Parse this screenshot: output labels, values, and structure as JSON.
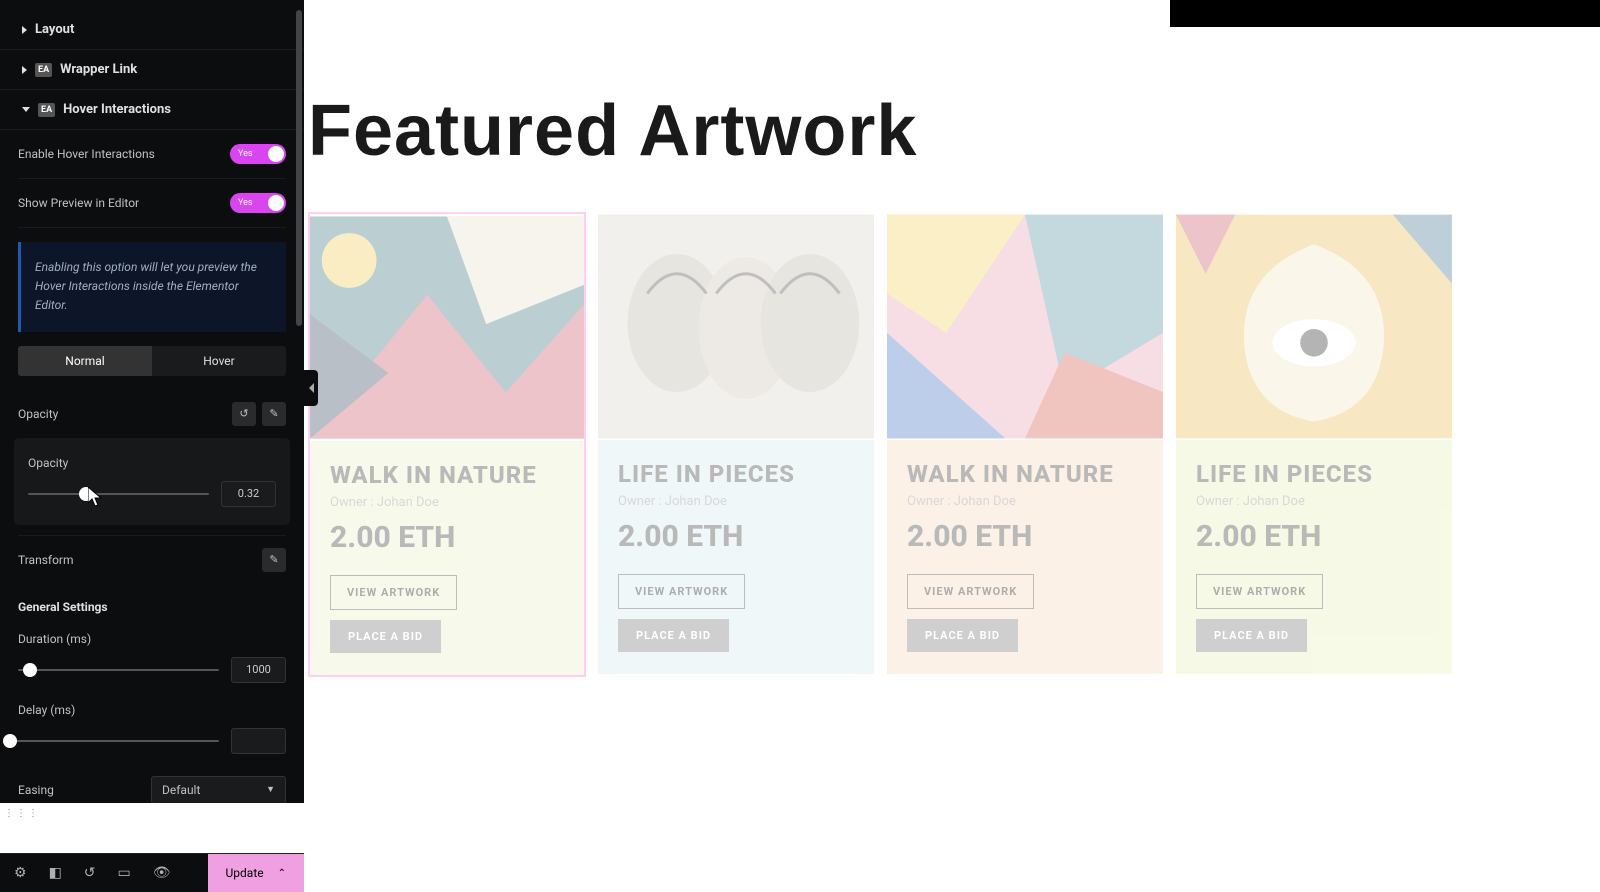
{
  "panel": {
    "layout_label": "Layout",
    "wrapper_link_label": "Wrapper Link",
    "hover_label": "Hover Interactions",
    "enable_label": "Enable Hover Interactions",
    "preview_label": "Show Preview in Editor",
    "toggle_yes": "Yes",
    "info_text": "Enabling this option will let you preview the Hover Interactions inside the Elementor Editor.",
    "tab_normal": "Normal",
    "tab_hover": "Hover",
    "opacity_label": "Opacity",
    "opacity_inner_label": "Opacity",
    "opacity_value": "0.32",
    "transform_label": "Transform",
    "general_label": "General Settings",
    "duration_label": "Duration (ms)",
    "duration_value": "1000",
    "delay_label": "Delay (ms)",
    "delay_value": "",
    "easing_label": "Easing",
    "easing_value": "Default"
  },
  "bottom": {
    "update_label": "Update"
  },
  "canvas": {
    "heading": "Featured Artwork",
    "cards": [
      {
        "title": "WALK IN NATURE",
        "owner": "Owner : Johan Doe",
        "price": "2.00 ETH",
        "view": "VIEW ARTWORK",
        "bid": "PLACE A BID",
        "bg": "bg-green"
      },
      {
        "title": "LIFE IN PIECES",
        "owner": "Owner : Johan Doe",
        "price": "2.00 ETH",
        "view": "VIEW ARTWORK",
        "bid": "PLACE A BID",
        "bg": "bg-blue"
      },
      {
        "title": "WALK IN NATURE",
        "owner": "Owner : Johan Doe",
        "price": "2.00 ETH",
        "view": "VIEW ARTWORK",
        "bid": "PLACE A BID",
        "bg": "bg-orange"
      },
      {
        "title": "LIFE IN PIECES",
        "owner": "Owner : Johan Doe",
        "price": "2.00 ETH",
        "view": "VIEW ARTWORK",
        "bid": "PLACE A BID",
        "bg": "bg-lime"
      }
    ]
  }
}
